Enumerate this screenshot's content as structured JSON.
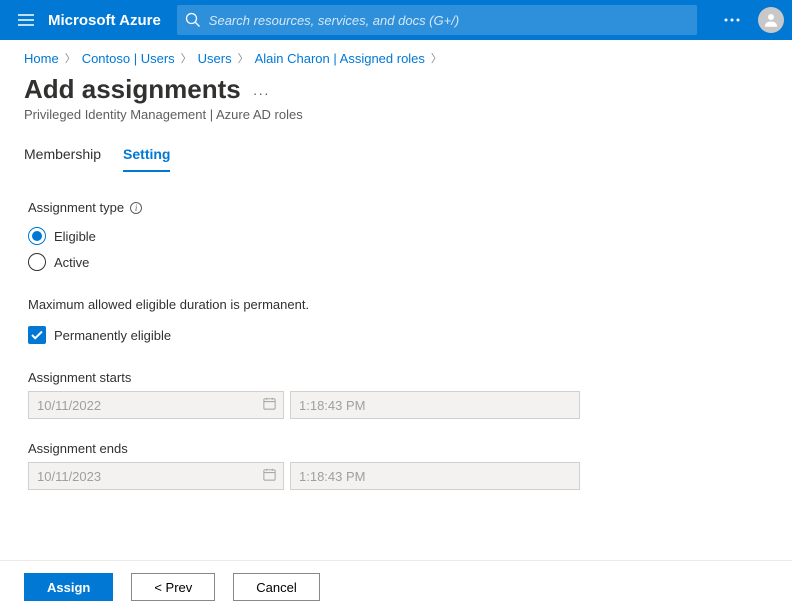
{
  "header": {
    "brand": "Microsoft Azure",
    "search_placeholder": "Search resources, services, and docs (G+/)"
  },
  "breadcrumb": {
    "items": [
      "Home",
      "Contoso | Users",
      "Users",
      "Alain Charon | Assigned roles"
    ]
  },
  "page": {
    "title": "Add assignments",
    "subtitle": "Privileged Identity Management | Azure AD roles"
  },
  "tabs": {
    "membership": "Membership",
    "setting": "Setting"
  },
  "form": {
    "assignment_type_label": "Assignment type",
    "radio_eligible": "Eligible",
    "radio_active": "Active",
    "duration_note": "Maximum allowed eligible duration is permanent.",
    "checkbox_permanent": "Permanently eligible",
    "starts_label": "Assignment starts",
    "starts_date": "10/11/2022",
    "starts_time": "1:18:43 PM",
    "ends_label": "Assignment ends",
    "ends_date": "10/11/2023",
    "ends_time": "1:18:43 PM"
  },
  "footer": {
    "assign": "Assign",
    "prev": "< Prev",
    "cancel": "Cancel"
  }
}
